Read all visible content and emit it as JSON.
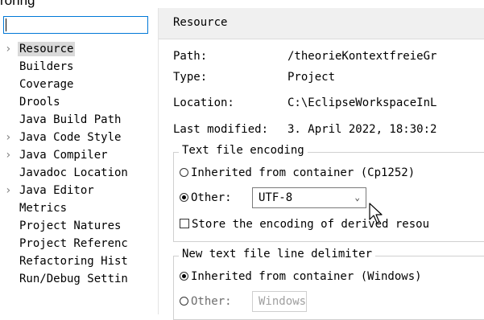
{
  "window": {
    "title_fragment": "ronng"
  },
  "filter": {
    "value": ""
  },
  "tree": [
    {
      "label": "Resource",
      "expandable": true,
      "selected": true
    },
    {
      "label": "Builders",
      "expandable": false
    },
    {
      "label": "Coverage",
      "expandable": false
    },
    {
      "label": "Drools",
      "expandable": false
    },
    {
      "label": "Java Build Path",
      "expandable": false
    },
    {
      "label": "Java Code Style",
      "expandable": true
    },
    {
      "label": "Java Compiler",
      "expandable": true
    },
    {
      "label": "Javadoc Location",
      "expandable": false
    },
    {
      "label": "Java Editor",
      "expandable": true
    },
    {
      "label": "Metrics",
      "expandable": false
    },
    {
      "label": "Project Natures",
      "expandable": false
    },
    {
      "label": "Project Referenc",
      "expandable": false
    },
    {
      "label": "Refactoring Hist",
      "expandable": false
    },
    {
      "label": "Run/Debug Settin",
      "expandable": false
    }
  ],
  "page": {
    "title": "Resource",
    "props": {
      "path_label": "Path:",
      "path_value": "/theorieKontextfreieGr",
      "type_label": "Type:",
      "type_value": "Project",
      "location_label": "Location:",
      "location_value": "C:\\EclipseWorkspaceInL",
      "modified_label": "Last modified:",
      "modified_value": "3. April 2022, 18:30:2"
    },
    "encoding": {
      "legend": "Text file encoding",
      "inherited_label": "Inherited from container (Cp1252)",
      "other_label": "Other:",
      "other_value": "UTF-8",
      "store_label": "Store the encoding of derived resou"
    },
    "delimiter": {
      "legend": "New text file line delimiter",
      "inherited_label": "Inherited from container (Windows)",
      "other_label": "Other:",
      "other_value": "Windows"
    }
  },
  "colors": {
    "focus": "#0078d7",
    "selection": "#d9d9d9",
    "header_bg": "#f0f0f0"
  }
}
